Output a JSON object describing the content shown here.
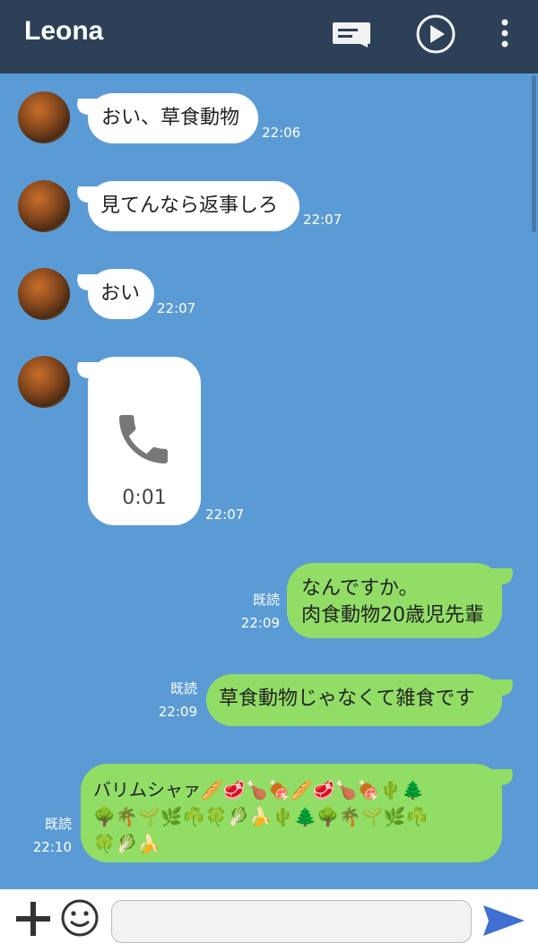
{
  "header": {
    "title": "Leona",
    "icons": [
      "notes-icon",
      "play-icon",
      "more-vertical-icon"
    ],
    "bg": "#2c4157"
  },
  "colors": {
    "chat_bg": "#5b9bd5",
    "incoming_bubble": "#ffffff",
    "outgoing_bubble": "#91dd66",
    "send_icon": "#3f6fd0"
  },
  "messages": [
    {
      "side": "in",
      "text": "おい、草食動物",
      "time": "22:06"
    },
    {
      "side": "in",
      "text": "見てんなら返事しろ",
      "time": "22:07"
    },
    {
      "side": "in",
      "text": "おい",
      "time": "22:07"
    },
    {
      "side": "in",
      "type": "call",
      "duration": "0:01",
      "time": "22:07"
    },
    {
      "side": "out",
      "lines": [
        "なんですか。",
        "肉食動物20歳児先輩"
      ],
      "read": "既読",
      "time": "22:09"
    },
    {
      "side": "out",
      "text": "草食動物じゃなくて雑食です",
      "read": "既読",
      "time": "22:09"
    },
    {
      "side": "out",
      "lines": [
        "バリムシャァ🥖🥩🍗🍖🥖🥩🍗🍖🌵🌲",
        "🌳🌴🌱🌿☘️🍀🥬🍌🌵🌲🌳🌴🌱🌿☘️",
        "🍀🥬🍌"
      ],
      "read": "既読",
      "time": "22:10"
    }
  ],
  "footer": {
    "input_value": "",
    "icons": [
      "plus-icon",
      "emoji-icon",
      "send-icon"
    ]
  }
}
